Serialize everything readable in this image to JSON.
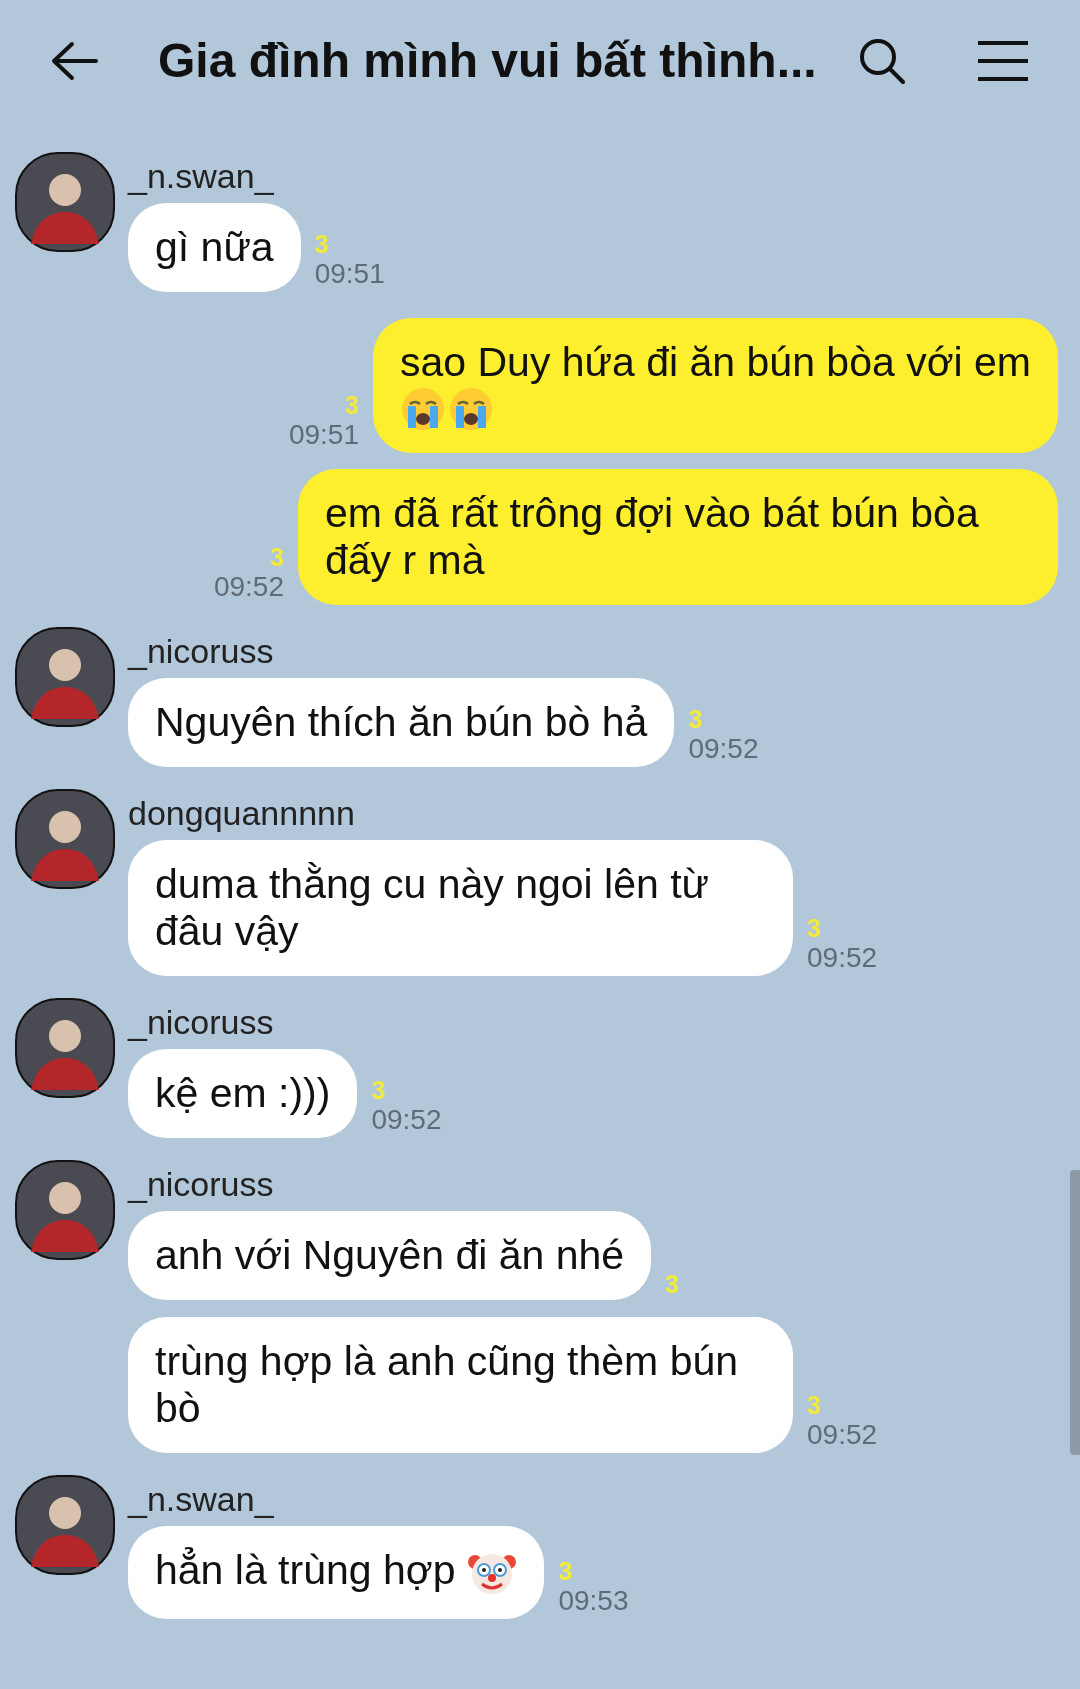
{
  "header": {
    "title": "Gia đình mình vui bất thình..."
  },
  "messages": [
    {
      "kind": "incoming",
      "sender": "_n.swan_",
      "bubbles": [
        {
          "text": "gì nữa",
          "unread": "3",
          "time": "09:51"
        }
      ]
    },
    {
      "kind": "outgoing",
      "bubbles": [
        {
          "text": "sao Duy hứa đi ăn bún bòa với em",
          "emoji": [
            {
              "kind": "crying"
            },
            {
              "kind": "crying"
            }
          ],
          "unread": "3",
          "time": "09:51"
        }
      ]
    },
    {
      "kind": "outgoing",
      "bubbles": [
        {
          "text": "em đã rất trông đợi vào bát bún bòa đấy r mà",
          "unread": "3",
          "time": "09:52"
        }
      ]
    },
    {
      "kind": "incoming",
      "sender": "_nicoruss",
      "bubbles": [
        {
          "text": "Nguyên thích ăn bún bò hả",
          "unread": "3",
          "time": "09:52"
        }
      ]
    },
    {
      "kind": "incoming",
      "sender": "dongquannnnn",
      "bubbles": [
        {
          "text": "duma thằng cu này ngoi lên từ đâu vậy",
          "unread": "3",
          "time": "09:52"
        }
      ]
    },
    {
      "kind": "incoming",
      "sender": "_nicoruss",
      "bubbles": [
        {
          "text": "kệ em :)))",
          "unread": "3",
          "time": "09:52"
        }
      ]
    },
    {
      "kind": "incoming",
      "sender": "_nicoruss",
      "bubbles": [
        {
          "text": "anh với Nguyên đi ăn nhé",
          "unread": "3"
        },
        {
          "text": "trùng hợp là anh cũng thèm bún bò",
          "unread": "3",
          "time": "09:52"
        }
      ]
    },
    {
      "kind": "incoming",
      "sender": "_n.swan_",
      "bubbles": [
        {
          "text": "hẳn là trùng hợp",
          "emoji": [
            {
              "kind": "clown"
            }
          ],
          "unread": "3",
          "time": "09:53"
        }
      ]
    }
  ]
}
